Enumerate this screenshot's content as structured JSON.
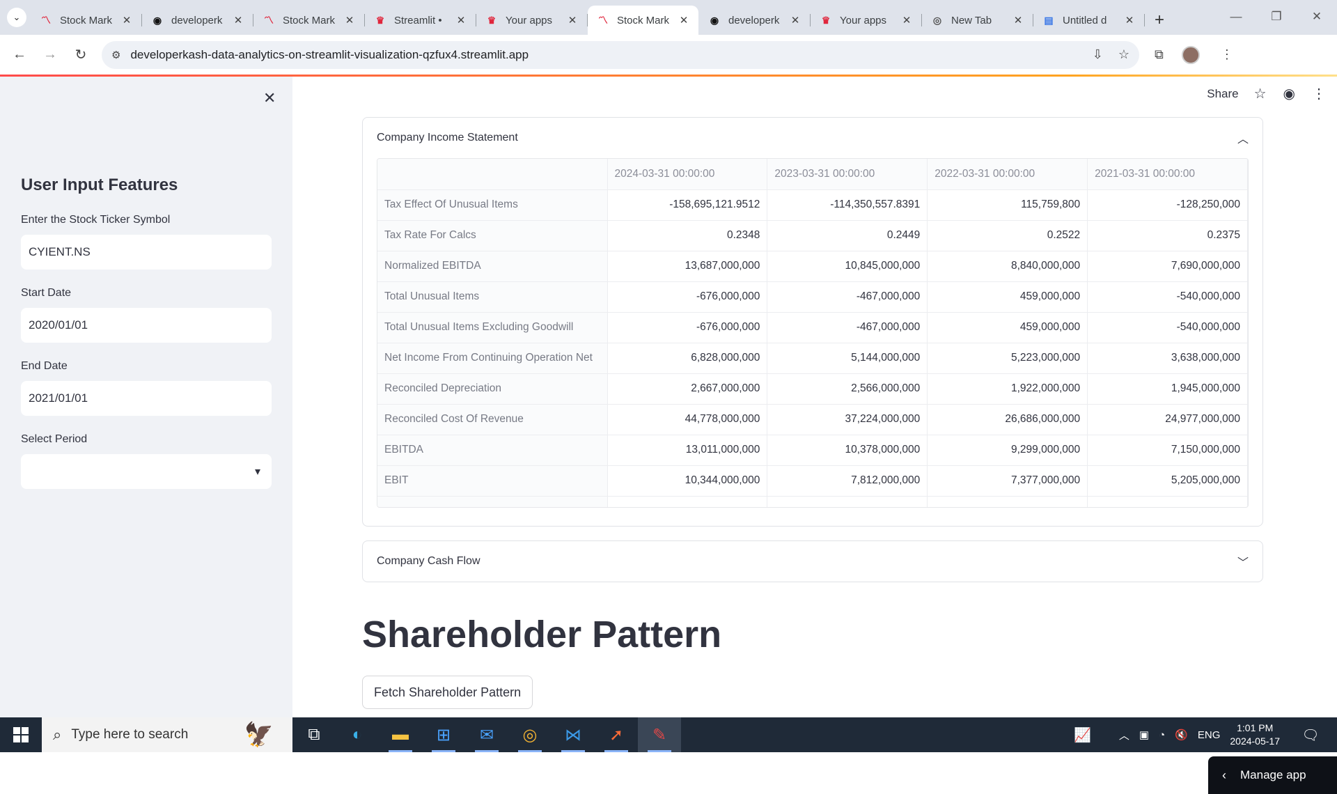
{
  "browser": {
    "tabs": [
      {
        "title": "Stock Mark",
        "icon": "streamlit-chart-icon",
        "active": false
      },
      {
        "title": "developerk",
        "icon": "github-icon",
        "active": false
      },
      {
        "title": "Stock Mark",
        "icon": "streamlit-chart-icon",
        "active": false
      },
      {
        "title": "Streamlit •",
        "icon": "streamlit-logo-icon",
        "active": false
      },
      {
        "title": "Your apps",
        "icon": "streamlit-logo-icon",
        "active": false
      },
      {
        "title": "Stock Mark",
        "icon": "streamlit-chart-icon",
        "active": true
      },
      {
        "title": "developerk",
        "icon": "github-icon",
        "active": false
      },
      {
        "title": "Your apps",
        "icon": "streamlit-logo-icon",
        "active": false
      },
      {
        "title": "New Tab",
        "icon": "chrome-icon",
        "active": false
      },
      {
        "title": "Untitled d",
        "icon": "docs-icon",
        "active": false
      }
    ],
    "url": "developerkash-data-analytics-on-streamlit-visualization-qzfux4.streamlit.app"
  },
  "sidebar": {
    "title": "User Input Features",
    "ticker_label": "Enter the Stock Ticker Symbol",
    "ticker_value": "CYIENT.NS",
    "start_label": "Start Date",
    "start_value": "2020/01/01",
    "end_label": "End Date",
    "end_value": "2021/01/01",
    "period_label": "Select Period",
    "period_value": ""
  },
  "header": {
    "share_label": "Share"
  },
  "income_statement": {
    "title": "Company Income Statement",
    "columns": [
      "2024-03-31 00:00:00",
      "2023-03-31 00:00:00",
      "2022-03-31 00:00:00",
      "2021-03-31 00:00:00"
    ],
    "rows": [
      {
        "label": "Tax Effect Of Unusual Items",
        "values": [
          "-158,695,121.9512",
          "-114,350,557.8391",
          "115,759,800",
          "-128,250,000"
        ]
      },
      {
        "label": "Tax Rate For Calcs",
        "values": [
          "0.2348",
          "0.2449",
          "0.2522",
          "0.2375"
        ]
      },
      {
        "label": "Normalized EBITDA",
        "values": [
          "13,687,000,000",
          "10,845,000,000",
          "8,840,000,000",
          "7,690,000,000"
        ]
      },
      {
        "label": "Total Unusual Items",
        "values": [
          "-676,000,000",
          "-467,000,000",
          "459,000,000",
          "-540,000,000"
        ]
      },
      {
        "label": "Total Unusual Items Excluding Goodwill",
        "values": [
          "-676,000,000",
          "-467,000,000",
          "459,000,000",
          "-540,000,000"
        ]
      },
      {
        "label": "Net Income From Continuing Operation Net",
        "values": [
          "6,828,000,000",
          "5,144,000,000",
          "5,223,000,000",
          "3,638,000,000"
        ]
      },
      {
        "label": "Reconciled Depreciation",
        "values": [
          "2,667,000,000",
          "2,566,000,000",
          "1,922,000,000",
          "1,945,000,000"
        ]
      },
      {
        "label": "Reconciled Cost Of Revenue",
        "values": [
          "44,778,000,000",
          "37,224,000,000",
          "26,686,000,000",
          "24,977,000,000"
        ]
      },
      {
        "label": "EBITDA",
        "values": [
          "13,011,000,000",
          "10,378,000,000",
          "9,299,000,000",
          "7,150,000,000"
        ]
      },
      {
        "label": "EBIT",
        "values": [
          "10,344,000,000",
          "7,812,000,000",
          "7,377,000,000",
          "5,205,000,000"
        ]
      }
    ]
  },
  "cash_flow": {
    "title": "Company Cash Flow"
  },
  "shareholder": {
    "heading": "Shareholder Pattern",
    "button_label": "Fetch Shareholder Pattern"
  },
  "manage_app": {
    "label": "Manage app"
  },
  "taskbar": {
    "search_placeholder": "Type here to search",
    "language": "ENG",
    "time": "1:01 PM",
    "date": "2024-05-17",
    "apps": [
      "task-view-icon",
      "edge-icon",
      "file-explorer-icon",
      "store-icon",
      "mail-icon",
      "chrome-icon",
      "vscode-icon",
      "postman-icon",
      "app-icon"
    ]
  }
}
